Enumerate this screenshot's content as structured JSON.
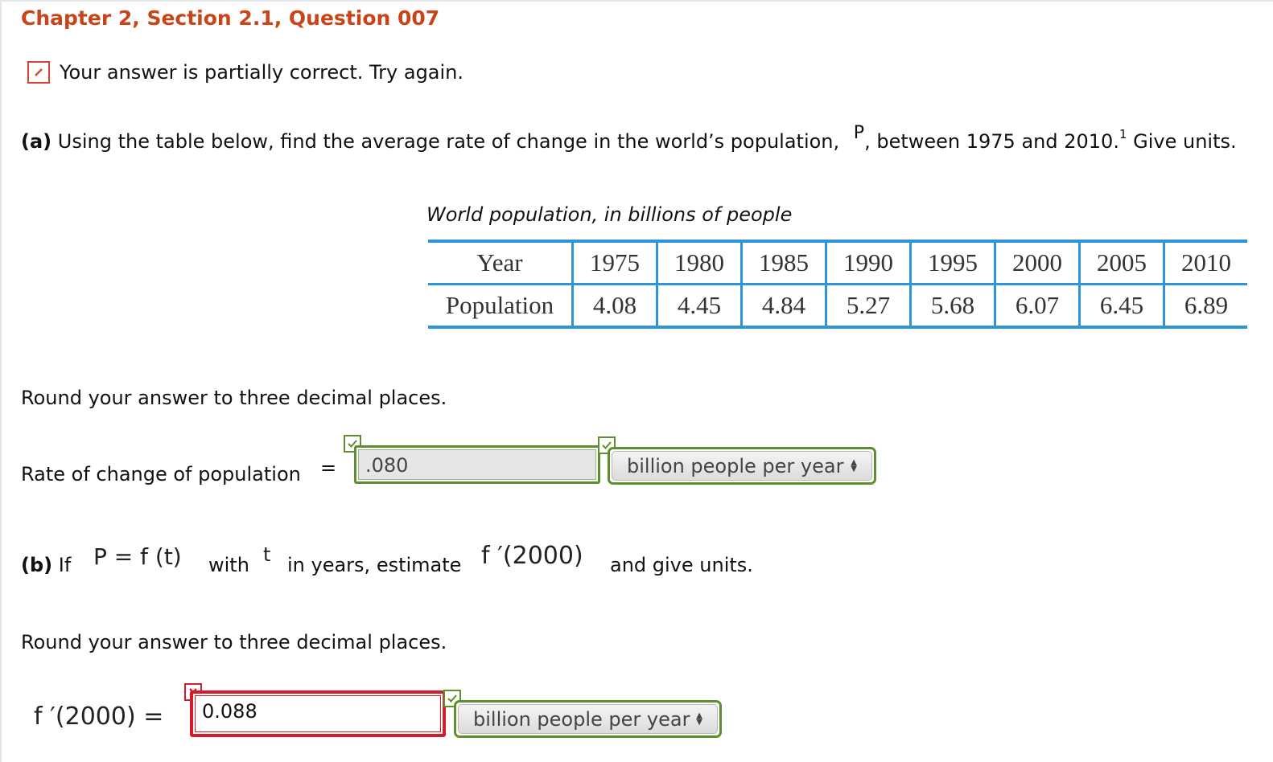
{
  "header": {
    "title": "Chapter 2, Section 2.1, Question 007"
  },
  "status": {
    "message": "Your answer is partially correct.  Try again."
  },
  "part_a": {
    "label": "(a)",
    "question_before": "Using the table below, find the average rate of change in the world’s population,",
    "variable": "P",
    "question_after": ", between 1975 and 2010.",
    "footnote": "1",
    "question_end": "Give units.",
    "table": {
      "caption": "World population, in billions of people",
      "row_headers": [
        "Year",
        "Population"
      ],
      "years": [
        "1975",
        "1980",
        "1985",
        "1990",
        "1995",
        "2000",
        "2005",
        "2010"
      ],
      "population": [
        "4.08",
        "4.45",
        "4.84",
        "5.27",
        "5.68",
        "6.07",
        "6.45",
        "6.89"
      ]
    },
    "instruction": "Round your answer to three decimal places.",
    "answer_label": "Rate of change of population",
    "equals": "=",
    "answer_value": ".080",
    "units_selected": "billion people per year"
  },
  "part_b": {
    "label": "(b)",
    "if_text": "If",
    "equation": "P = f (t)",
    "with_text": "with",
    "t_var": "t",
    "in_years_text": "in years, estimate",
    "expression": "f ′(2000)",
    "give_units_text": "and give units.",
    "instruction": "Round your answer to three decimal places.",
    "answer_label": "f ′(2000) =",
    "answer_value": "0.088",
    "units_selected": "billion people per year"
  },
  "colors": {
    "title": "#c8451a",
    "table_border": "#2f95d9",
    "correct": "#5e8f2e",
    "incorrect": "#d31d2a"
  }
}
